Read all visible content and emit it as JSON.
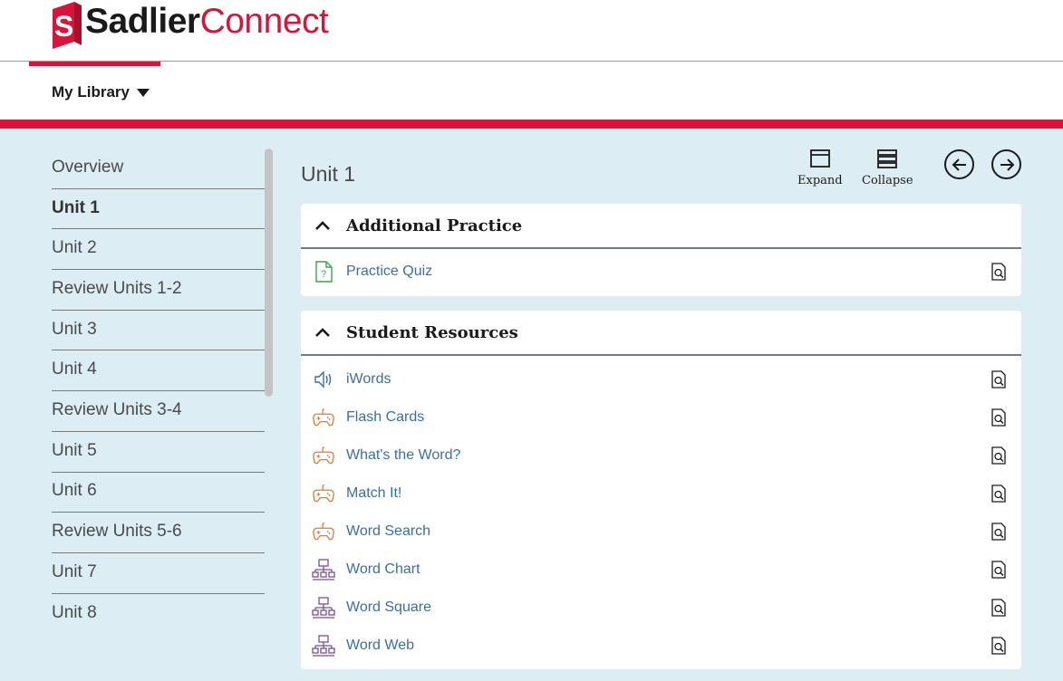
{
  "brand": {
    "name_bold": "Sadlier",
    "name_light": "Connect",
    "logo_letter": "S",
    "primary_color": "#d9143a",
    "dark_text": "#1a1a1a"
  },
  "nav": {
    "my_library_label": "My Library",
    "caret_icon": "caret-down-icon"
  },
  "sidebar": {
    "items": [
      {
        "label": "Overview",
        "active": false
      },
      {
        "label": "Unit 1",
        "active": true
      },
      {
        "label": "Unit 2",
        "active": false
      },
      {
        "label": "Review Units 1-2",
        "active": false
      },
      {
        "label": "Unit 3",
        "active": false
      },
      {
        "label": "Unit 4",
        "active": false
      },
      {
        "label": "Review Units 3-4",
        "active": false
      },
      {
        "label": "Unit 5",
        "active": false
      },
      {
        "label": "Unit 6",
        "active": false
      },
      {
        "label": "Review Units 5-6",
        "active": false
      },
      {
        "label": "Unit 7",
        "active": false
      },
      {
        "label": "Unit 8",
        "active": false
      }
    ]
  },
  "main": {
    "title": "Unit 1",
    "toolbar": {
      "expand_label": "Expand",
      "collapse_label": "Collapse",
      "prev_icon": "arrow-left-icon",
      "next_icon": "arrow-right-icon"
    },
    "panels": [
      {
        "title": "Additional Practice",
        "items": [
          {
            "label": "Practice Quiz",
            "icon": "quiz-icon"
          }
        ]
      },
      {
        "title": "Student Resources",
        "items": [
          {
            "label": "iWords",
            "icon": "audio-icon"
          },
          {
            "label": "Flash Cards",
            "icon": "game-controller-icon"
          },
          {
            "label": "What's the Word?",
            "icon": "game-controller-icon"
          },
          {
            "label": "Match It!",
            "icon": "game-controller-icon"
          },
          {
            "label": "Word Search",
            "icon": "game-controller-icon"
          },
          {
            "label": "Word Chart",
            "icon": "org-chart-icon"
          },
          {
            "label": "Word Square",
            "icon": "org-chart-icon"
          },
          {
            "label": "Word Web",
            "icon": "org-chart-icon"
          }
        ]
      }
    ]
  },
  "colors": {
    "content_bg": "#dcedf4",
    "link": "#3b6ea8",
    "quiz_icon": "#3aa64a",
    "audio_icon": "#3b6ea8",
    "game_icon": "#e8782a",
    "chart_icon": "#7a4f9a"
  }
}
